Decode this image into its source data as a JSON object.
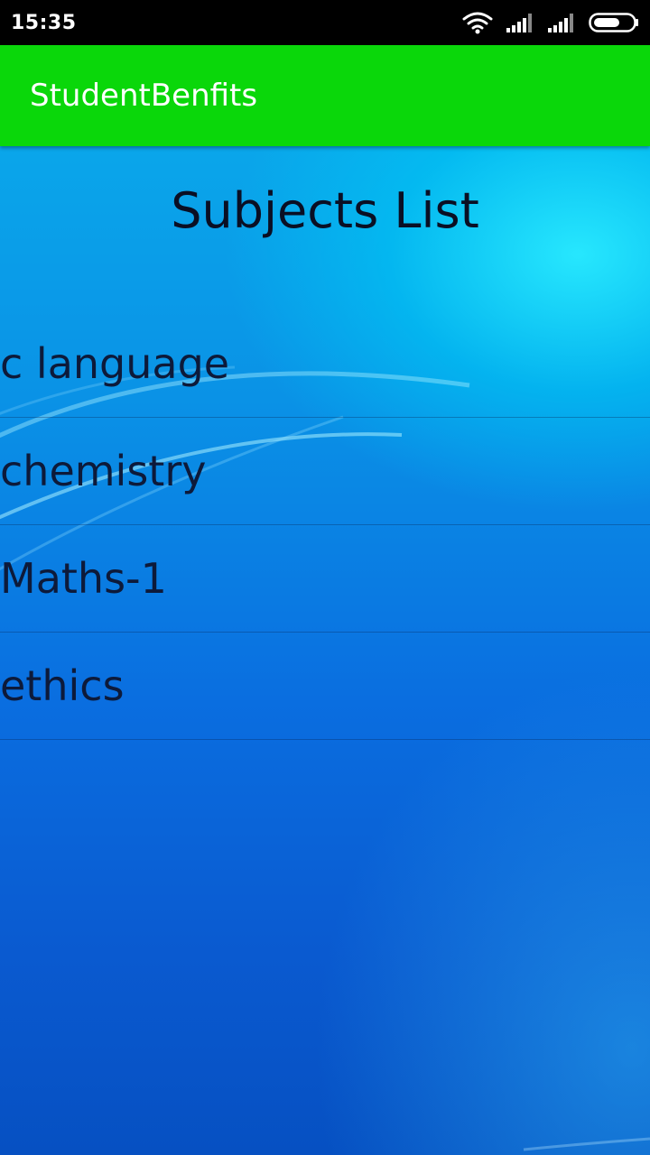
{
  "status_bar": {
    "time": "15:35",
    "icons": [
      "wifi-icon",
      "signal-icon",
      "signal-icon",
      "battery-icon"
    ]
  },
  "app_bar": {
    "title": "StudentBenfits",
    "background_color": "#0ad70a"
  },
  "main": {
    "heading": "Subjects List",
    "subjects": [
      {
        "label": "c language"
      },
      {
        "label": "chemistry"
      },
      {
        "label": "Maths-1"
      },
      {
        "label": "ethics"
      }
    ]
  }
}
